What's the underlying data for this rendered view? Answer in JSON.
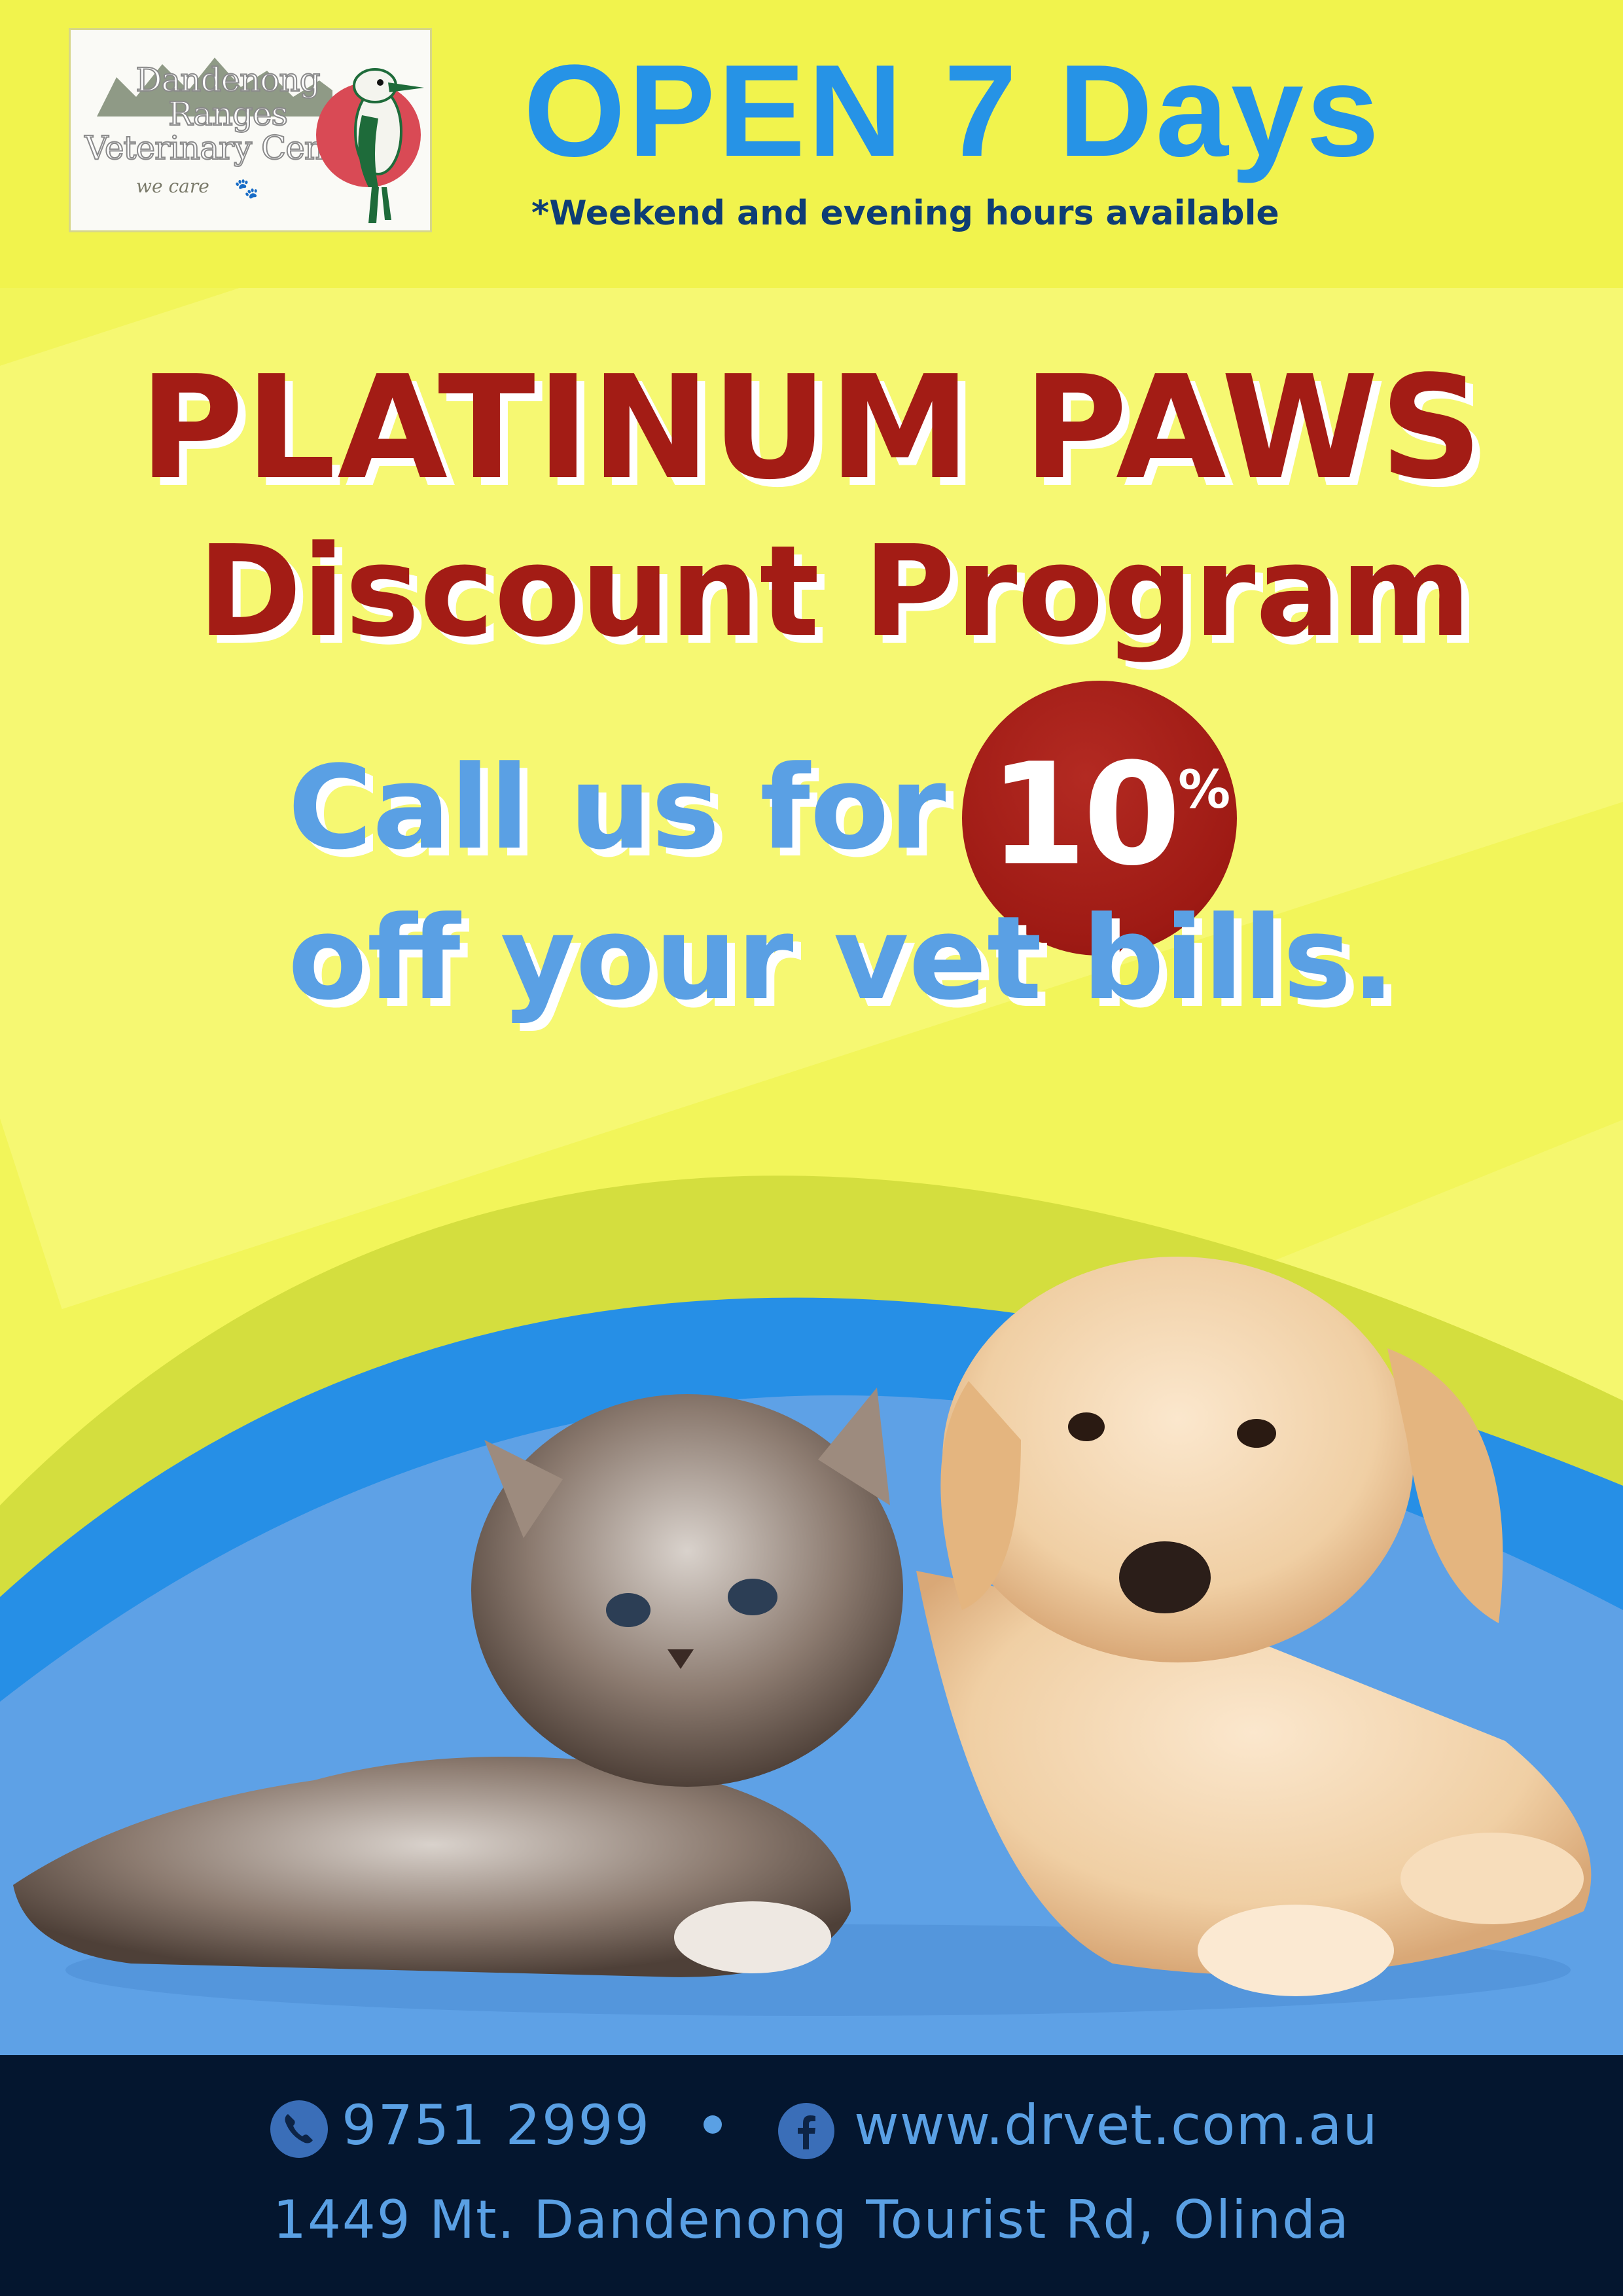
{
  "header": {
    "logo": {
      "name_lines": [
        "Dandenong",
        "Ranges",
        "Veterinary Centre"
      ],
      "tagline": "we care"
    },
    "open_heading": "OPEN 7 Days",
    "open_subtext": "*Weekend and evening hours available"
  },
  "promo": {
    "title": "PLATINUM PAWS",
    "subtitle": "Discount Program",
    "call_line_1": "Call us for",
    "discount_number": "10",
    "discount_symbol": "%",
    "call_line_2": "off your vet bills."
  },
  "footer": {
    "phone": "9751 2999",
    "website": "www.drvet.com.au",
    "address": "1449 Mt. Dandenong Tourist Rd, Olinda"
  },
  "icons": [
    "phone-icon",
    "facebook-icon",
    "kookaburra-logo-icon",
    "paw-icon"
  ],
  "colors": {
    "accent_yellow": "#f1f34d",
    "heading_blue": "#2693e6",
    "title_red": "#a31c15",
    "light_blue": "#5aa0e4",
    "footer_navy": "#04162f"
  }
}
